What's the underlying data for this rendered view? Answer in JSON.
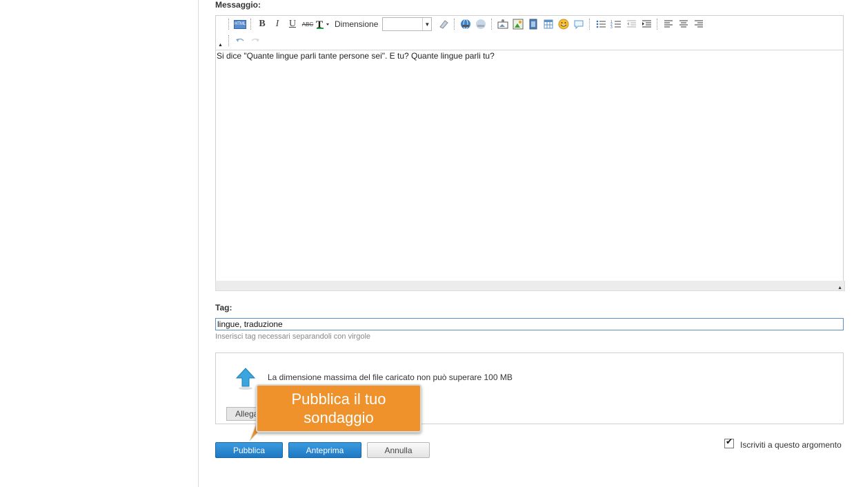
{
  "form": {
    "message_label": "Messaggio:",
    "tag_label": "Tag:",
    "tag_value": "lingue, traduzione",
    "tag_hint": "Inserisci tag necessari separandoli con virgole"
  },
  "editor": {
    "size_label": "Dimensione",
    "size_value": "",
    "content": "Si dice \"Quante lingue parli tante persone sei\". E tu? Quante lingue parli tu?",
    "toolbar_row1": [
      "html-icon",
      "bold-icon",
      "italic-icon",
      "underline-icon",
      "strikethrough-icon",
      "text-color-icon",
      "eraser-icon",
      "link-icon",
      "unlink-icon",
      "image-icon",
      "picture-icon",
      "video-icon",
      "table-icon",
      "smiley-icon",
      "quote-icon",
      "bullet-list-icon",
      "numbered-list-icon",
      "outdent-icon",
      "indent-icon",
      "align-left-icon",
      "align-center-icon",
      "align-right-icon"
    ],
    "toolbar_row2": [
      "undo-icon",
      "redo-icon"
    ],
    "bold_glyph": "B",
    "italic_glyph": "I",
    "underline_glyph": "U",
    "strike_glyph": "ABC",
    "html_glyph": "HTML"
  },
  "upload": {
    "max_size_text": "La dimensione massima del file caricato non può superare 100 MB",
    "attach_label": "Allega"
  },
  "callout": {
    "line1": "Pubblica il tuo",
    "line2": "sondaggio",
    "color": "#f0922b"
  },
  "actions": {
    "publish_label": "Pubblica",
    "preview_label": "Anteprima",
    "cancel_label": "Annulla"
  },
  "subscribe": {
    "label": "Iscriviti a questo argomento",
    "checked": true
  },
  "colors": {
    "primary_button": "#1f78c2",
    "tag_border": "#5b8fbf"
  }
}
